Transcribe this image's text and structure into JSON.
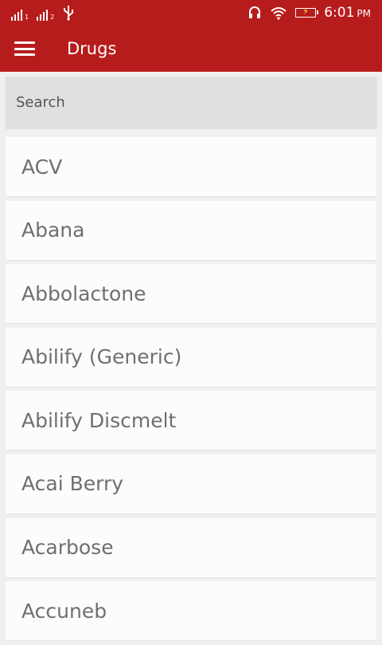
{
  "status_bar": {
    "sim1_label": "1",
    "sim2_label": "2",
    "usb_icon": "usb-icon",
    "headset_icon": "headset-icon",
    "wifi_icon": "wifi-icon",
    "battery_icon": "battery-charging-icon",
    "time": "6:01",
    "ampm": "PM"
  },
  "toolbar": {
    "title": "Drugs",
    "menu_icon": "hamburger-menu-icon",
    "background_color": "#b71c1c"
  },
  "search": {
    "placeholder": "Search",
    "value": ""
  },
  "drug_list": {
    "items": [
      {
        "label": "ACV"
      },
      {
        "label": "Abana"
      },
      {
        "label": "Abbolactone"
      },
      {
        "label": "Abilify (Generic)"
      },
      {
        "label": "Abilify Discmelt"
      },
      {
        "label": "Acai Berry"
      },
      {
        "label": "Acarbose"
      },
      {
        "label": "Accuneb"
      }
    ]
  }
}
